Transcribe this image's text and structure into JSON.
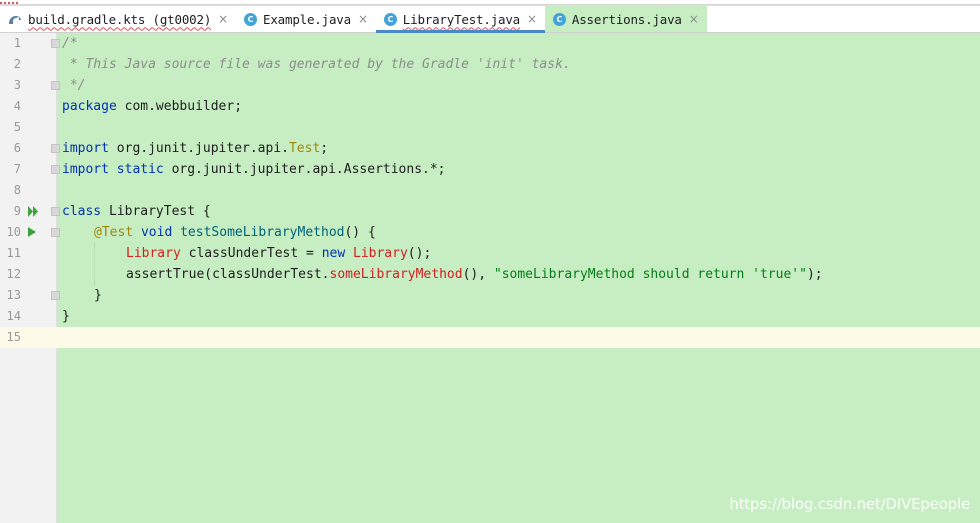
{
  "tabs": [
    {
      "label": "build.gradle.kts (gt0002)",
      "icon": "gradle-icon",
      "close": "×"
    },
    {
      "label": "Example.java",
      "icon": "java-class-icon",
      "icon_letter": "C",
      "close": "×"
    },
    {
      "label": "LibraryTest.java",
      "icon": "java-test-class-icon",
      "icon_letter": "C",
      "close": "×"
    },
    {
      "label": "Assertions.java",
      "icon": "java-class-icon",
      "icon_letter": "C",
      "close": "×"
    }
  ],
  "lines": {
    "n1": "1",
    "n2": "2",
    "n3": "3",
    "n4": "4",
    "n5": "5",
    "n6": "6",
    "n7": "7",
    "n8": "8",
    "n9": "9",
    "n10": "10",
    "n11": "11",
    "n12": "12",
    "n13": "13",
    "n14": "14",
    "n15": "15"
  },
  "code": {
    "l1": "/*",
    "l2": " * This Java source file was generated by the Gradle 'init' task.",
    "l3": " */",
    "l4_kw": "package",
    "l4_rest": " com.webbuilder;",
    "l6_kw": "import",
    "l6_rest": " org.junit.jupiter.api.",
    "l6_ann": "Test",
    "l6_end": ";",
    "l7_kw": "import static",
    "l7_rest": " org.junit.jupiter.api.Assertions.*;",
    "l9_kw": "class",
    "l9_rest": " LibraryTest {",
    "l10_ann": "@Test",
    "l10_kw": " void",
    "l10_method": " testSomeLibraryMethod",
    "l10_rest": "() {",
    "l11_type": "Library",
    "l11_mid": " classUnderTest = ",
    "l11_kw": "new",
    "l11_type2": " Library",
    "l11_end": "();",
    "l12_start": "assertTrue(classUnderTest.",
    "l12_method": "someLibraryMethod",
    "l12_mid": "(), ",
    "l12_str": "\"someLibraryMethod should return 'true'\"",
    "l12_end": ");",
    "l13": "}",
    "l14": "}"
  },
  "watermark": "https://blog.csdn.net/DIVEpeople",
  "colors": {
    "editor_bg": "#c7edc3",
    "keyword": "#0033b3",
    "annotation": "#9e880d",
    "string": "#067d17",
    "error_red": "#d02020",
    "comment": "#8c8c8c",
    "active_tab_underline": "#4a88c7",
    "current_line": "#fdfbe8"
  }
}
